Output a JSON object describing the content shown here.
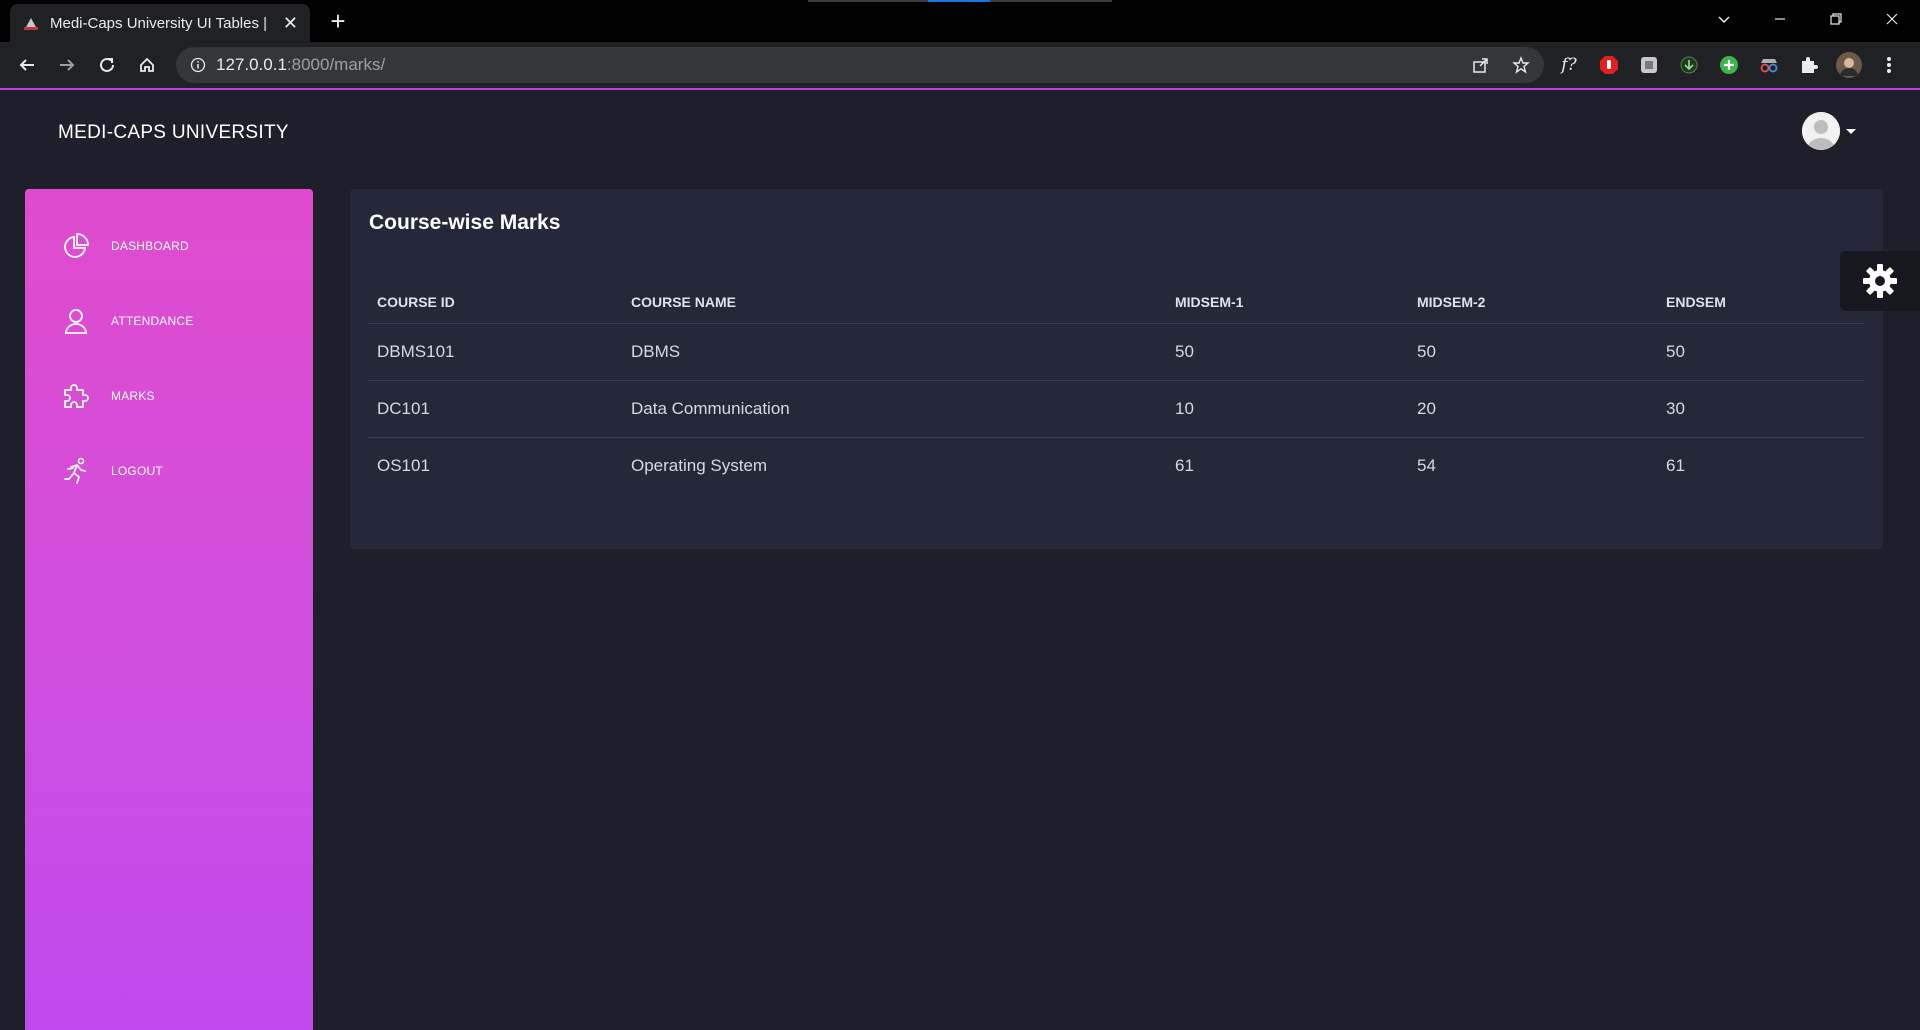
{
  "browser": {
    "tab_title": "Medi-Caps University UI Tables |",
    "url_host": "127.0.0.1",
    "url_rest": ":8000/marks/"
  },
  "page": {
    "brand": "MEDI-CAPS UNIVERSITY"
  },
  "sidebar": {
    "items": [
      {
        "label": "DASHBOARD",
        "icon": "pie-chart-icon"
      },
      {
        "label": "ATTENDANCE",
        "icon": "user-icon"
      },
      {
        "label": "MARKS",
        "icon": "puzzle-icon"
      },
      {
        "label": "LOGOUT",
        "icon": "running-person-icon"
      }
    ]
  },
  "marks": {
    "title": "Course-wise Marks",
    "columns": [
      "COURSE ID",
      "COURSE NAME",
      "MIDSEM-1",
      "MIDSEM-2",
      "ENDSEM"
    ],
    "rows": [
      [
        "DBMS101",
        "DBMS",
        "50",
        "50",
        "50"
      ],
      [
        "DC101",
        "Data Communication",
        "10",
        "20",
        "30"
      ],
      [
        "OS101",
        "Operating System",
        "61",
        "54",
        "61"
      ]
    ]
  },
  "colors": {
    "sidebar_top": "#e04bce",
    "sidebar_bottom": "#bf4af0",
    "page_bg": "#1e1f2a",
    "card_bg": "#252839"
  }
}
